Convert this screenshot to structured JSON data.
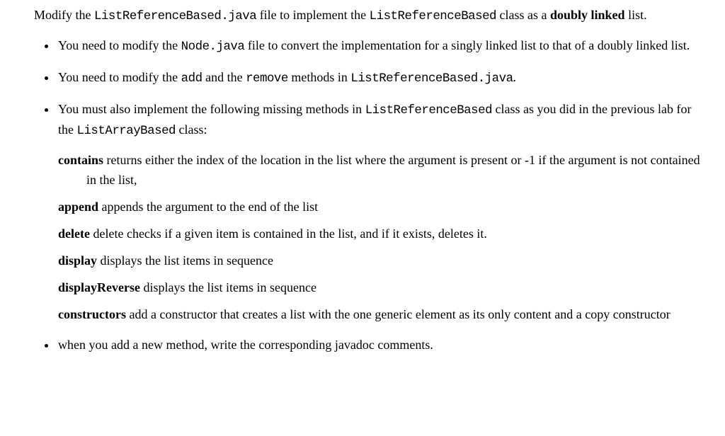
{
  "intro": {
    "p1_1": "Modify the ",
    "p1_code1": "ListReferenceBased.java",
    "p1_2": " file to implement the ",
    "p1_code2": "ListReferenceBased",
    "p1_3": " class as a ",
    "p1_bold": "doubly linked",
    "p1_4": " list."
  },
  "bullets": {
    "b1_1": "You need to modify the ",
    "b1_code": "Node.java",
    "b1_2": " file to convert the implementation for a singly linked list to that of a doubly linked list.",
    "b2_1": "You need to modify the ",
    "b2_code1": "add",
    "b2_2": " and the ",
    "b2_code2": "remove",
    "b2_3": " methods in ",
    "b2_code3": "ListReferenceBased.java",
    "b2_4": ".",
    "b3_1": "You must also implement the following missing methods in ",
    "b3_code1": "ListReferenceBased",
    "b3_2": " class as you did in the previous lab for the ",
    "b3_code2": "ListArrayBased",
    "b3_3": " class:",
    "b4": "when you add a new method, write the corresponding javadoc comments."
  },
  "methods": {
    "m1_name": "contains",
    "m1_desc": " returns either the index of the location in the list where the argument is present or -1 if the argument is not contained in the list,",
    "m2_name": "append",
    "m2_desc": " appends the argument to the end of the list",
    "m3_name": "delete",
    "m3_desc": " delete checks if a given item is contained in the list, and if it exists, deletes it.",
    "m4_name": "display",
    "m4_desc": " displays the list items in sequence",
    "m5_name": "displayReverse",
    "m5_desc": " displays the list items in sequence",
    "m6_name": "constructors",
    "m6_desc": " add a constructor that creates a list with the one generic element as its only content and a copy constructor"
  }
}
